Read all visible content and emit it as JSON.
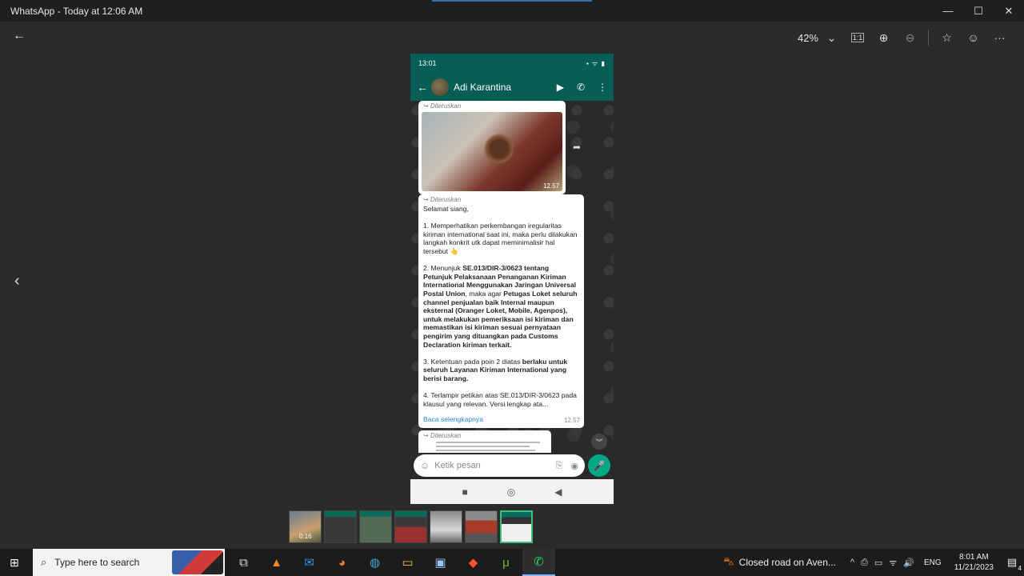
{
  "window": {
    "title": "WhatsApp - Today at 12:06 AM",
    "controls": {
      "minimize": "—",
      "maximize": "☐",
      "close": "✕"
    }
  },
  "viewer_toolbar": {
    "back_icon": "←",
    "zoom_level": "42%",
    "zoom_dropdown_icon": "⌄",
    "actual_size_icon": "1:1",
    "zoom_in_icon": "⊕",
    "zoom_out_icon": "⊖",
    "favorite_icon": "☆",
    "feedback_icon": "☺",
    "more_icon": "···",
    "prev_icon": "‹"
  },
  "phone": {
    "status_time": "13:01",
    "status_icons": "▪ ᯤ ▮",
    "contact_name": "Adi Karantina",
    "appbar_back": "←",
    "video_icon": "▶",
    "call_icon": "✆",
    "menu_icon": "⋮",
    "forwarded_label": "Diteruskan",
    "msg1_time": "12.57",
    "share_icon": "➦",
    "msg2": {
      "p1": "Selamat siang,",
      "p2": "1. Memperhatikan perkembangan iregularitas kiriman international saat ini, maka perlu dilakukan langkah konkrit utk dapat meminimalisir hal tersebut 👆",
      "p3_a": "2. Menunjuk ",
      "p3_b": "SE.013/DIR-3/0623 tentang Petunjuk Pelaksanaan Penanganan Kiriman International Menggunakan Jaringan Universal Postal Union",
      "p3_c": ", maka agar ",
      "p3_d": "Petugas Loket seluruh channel penjualan baik Internal maupun eksternal (Oranger Loket, Mobile, Agenpos), untuk melakukan pemeriksaan isi kiriman dan memastikan isi kiriman sesuai pernyataan pengirim yang dituangkan pada Customs Declaration kiriman terkait.",
      "p4_a": "3. Ketentuan pada poin 2 diatas ",
      "p4_b": "berlaku untuk seluruh Layanan Kiriman International yang berisi barang.",
      "p5": "4. Terlampir petikan atas SE.013/DIR-3/0623 pada klausul yang relevan. Versi lengkap ata...",
      "read_more": "Baca selengkapnya",
      "time": "12.57"
    },
    "scroll_down_icon": "︾",
    "input_placeholder": "Ketik pesan",
    "emoji_icon": "☺",
    "attach_icon": "⎘",
    "camera_icon": "◉",
    "mic_icon": "🎤",
    "nav_square": "■",
    "nav_home": "◎",
    "nav_back": "◀"
  },
  "filmstrip": {
    "first_duration": "0:16"
  },
  "taskbar": {
    "start_icon": "⊞",
    "search_icon": "⌕",
    "search_placeholder": "Type here to search",
    "apps": [
      "⧉",
      "▲",
      "✉",
      "◕",
      "◍",
      "▭",
      "▣",
      "◆",
      "μ",
      "✆"
    ],
    "news": "Closed road on Aven...",
    "news_icon": "⛍",
    "tray_icons": [
      "^",
      "⎙",
      "▭",
      "ᯤ",
      "🔊"
    ],
    "lang": "ENG",
    "time": "8:01 AM",
    "date": "11/21/2023",
    "notif_icon": "▤",
    "notif_count": "4"
  }
}
